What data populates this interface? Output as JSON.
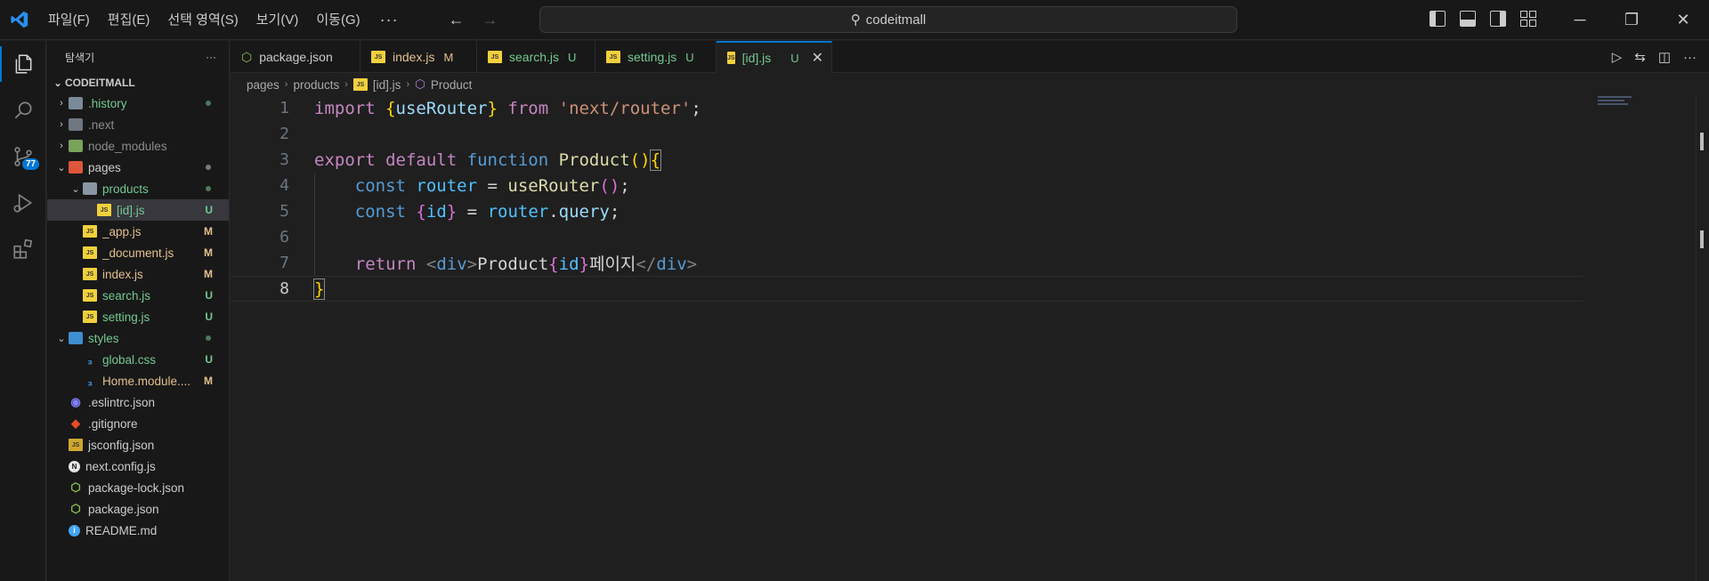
{
  "titlebar": {
    "menus": [
      "파일(F)",
      "편집(E)",
      "선택 영역(S)",
      "보기(V)",
      "이동(G)"
    ],
    "more": "···",
    "search_text": "codeitmall"
  },
  "activity": {
    "scm_badge": "77"
  },
  "sidebar": {
    "title": "탐색기",
    "more": "···",
    "project": "CODEITMALL",
    "items": [
      {
        "name": ".history",
        "status": "",
        "dot": true
      },
      {
        "name": ".next",
        "status": "",
        "dot": false
      },
      {
        "name": "node_modules",
        "status": "",
        "dot": false
      },
      {
        "name": "pages",
        "status": "",
        "dot": true
      },
      {
        "name": "products",
        "status": "",
        "dot": true
      },
      {
        "name": "[id].js",
        "status": "U"
      },
      {
        "name": "_app.js",
        "status": "M"
      },
      {
        "name": "_document.js",
        "status": "M"
      },
      {
        "name": "index.js",
        "status": "M"
      },
      {
        "name": "search.js",
        "status": "U"
      },
      {
        "name": "setting.js",
        "status": "U"
      },
      {
        "name": "styles",
        "status": "",
        "dot": true
      },
      {
        "name": "global.css",
        "status": "U"
      },
      {
        "name": "Home.module....",
        "status": "M"
      },
      {
        "name": ".eslintrc.json",
        "status": ""
      },
      {
        "name": ".gitignore",
        "status": ""
      },
      {
        "name": "jsconfig.json",
        "status": ""
      },
      {
        "name": "next.config.js",
        "status": ""
      },
      {
        "name": "package-lock.json",
        "status": ""
      },
      {
        "name": "package.json",
        "status": ""
      },
      {
        "name": "README.md",
        "status": ""
      }
    ]
  },
  "tabs": [
    {
      "label": "package.json",
      "status": ""
    },
    {
      "label": "index.js",
      "status": "M"
    },
    {
      "label": "search.js",
      "status": "U"
    },
    {
      "label": "setting.js",
      "status": "U"
    },
    {
      "label": "[id].js",
      "status": "U"
    }
  ],
  "breadcrumb": [
    "pages",
    "products",
    "[id].js",
    "Product"
  ],
  "editor": {
    "line_numbers": [
      "1",
      "2",
      "3",
      "4",
      "5",
      "6",
      "7",
      "8"
    ],
    "current_line": "8",
    "tokens": {
      "l1": [
        "import",
        "{",
        "useRouter",
        "}",
        "from",
        "'next/router'",
        ";"
      ],
      "l3": [
        "export",
        "default",
        "function",
        "Product",
        "(",
        ")",
        "{"
      ],
      "l4": [
        "const",
        "router",
        "=",
        "useRouter",
        "(",
        ")",
        ";"
      ],
      "l5": [
        "const",
        "{",
        "id",
        "}",
        "=",
        "router",
        ".",
        "query",
        ";"
      ],
      "l7": [
        "return",
        "<",
        "div",
        ">",
        "Product",
        "{",
        "id",
        "}",
        "페이지",
        "</",
        "div",
        ">"
      ],
      "l8": [
        "}"
      ]
    }
  }
}
